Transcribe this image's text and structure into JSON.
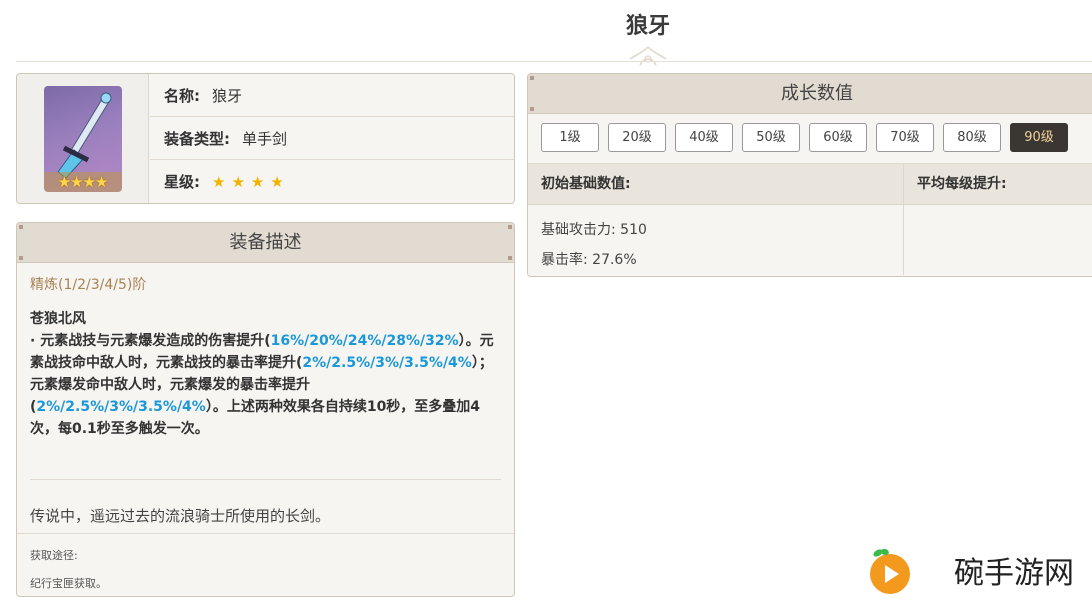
{
  "page": {
    "title": "狼牙"
  },
  "info": {
    "name_label": "名称:",
    "name_value": "狼牙",
    "type_label": "装备类型:",
    "type_value": "单手剑",
    "rarity_label": "星级:",
    "rarity_stars": 4
  },
  "description": {
    "header": "装备描述",
    "refinement": "精炼(1/2/3/4/5)阶",
    "passive_name": "苍狼北风",
    "passive_parts": [
      "· 元素战技与元素爆发造成的伤害提升(",
      "16%/20%/24%/28%/32%",
      "）。元素战技命中敌人时，元素战技的暴击率提升(",
      "2%/2.5%/3%/3.5%/4%",
      "）；元素爆发命中敌人时，元素爆发的暴击率提升(",
      "2%/2.5%/3%/3.5%/4%",
      "）。上述两种效果各自持续10秒，至多叠加4次，每0.1秒至多触发一次。"
    ],
    "lore": "传说中，遥远过去的流浪骑士所使用的长剑。",
    "source_label": "获取途径:",
    "source_value": "纪行宝匣获取。"
  },
  "growth": {
    "header": "成长数值",
    "levels": [
      "1级",
      "20级",
      "40级",
      "50级",
      "60级",
      "70级",
      "80级",
      "90级"
    ],
    "active_level": "90级",
    "col_base": "初始基础数值:",
    "col_per_level": "平均每级提升:",
    "base_attack": "基础攻击力: 510",
    "crit_rate": "暴击率: 27.6%"
  },
  "watermark": {
    "text": "碗手游网"
  },
  "colors": {
    "accent_blue": "#1b98d8",
    "active_level_bg": "#3a3631",
    "active_level_text": "#f2d19c",
    "refine_text": "#a88354",
    "star": "#f0b400"
  }
}
